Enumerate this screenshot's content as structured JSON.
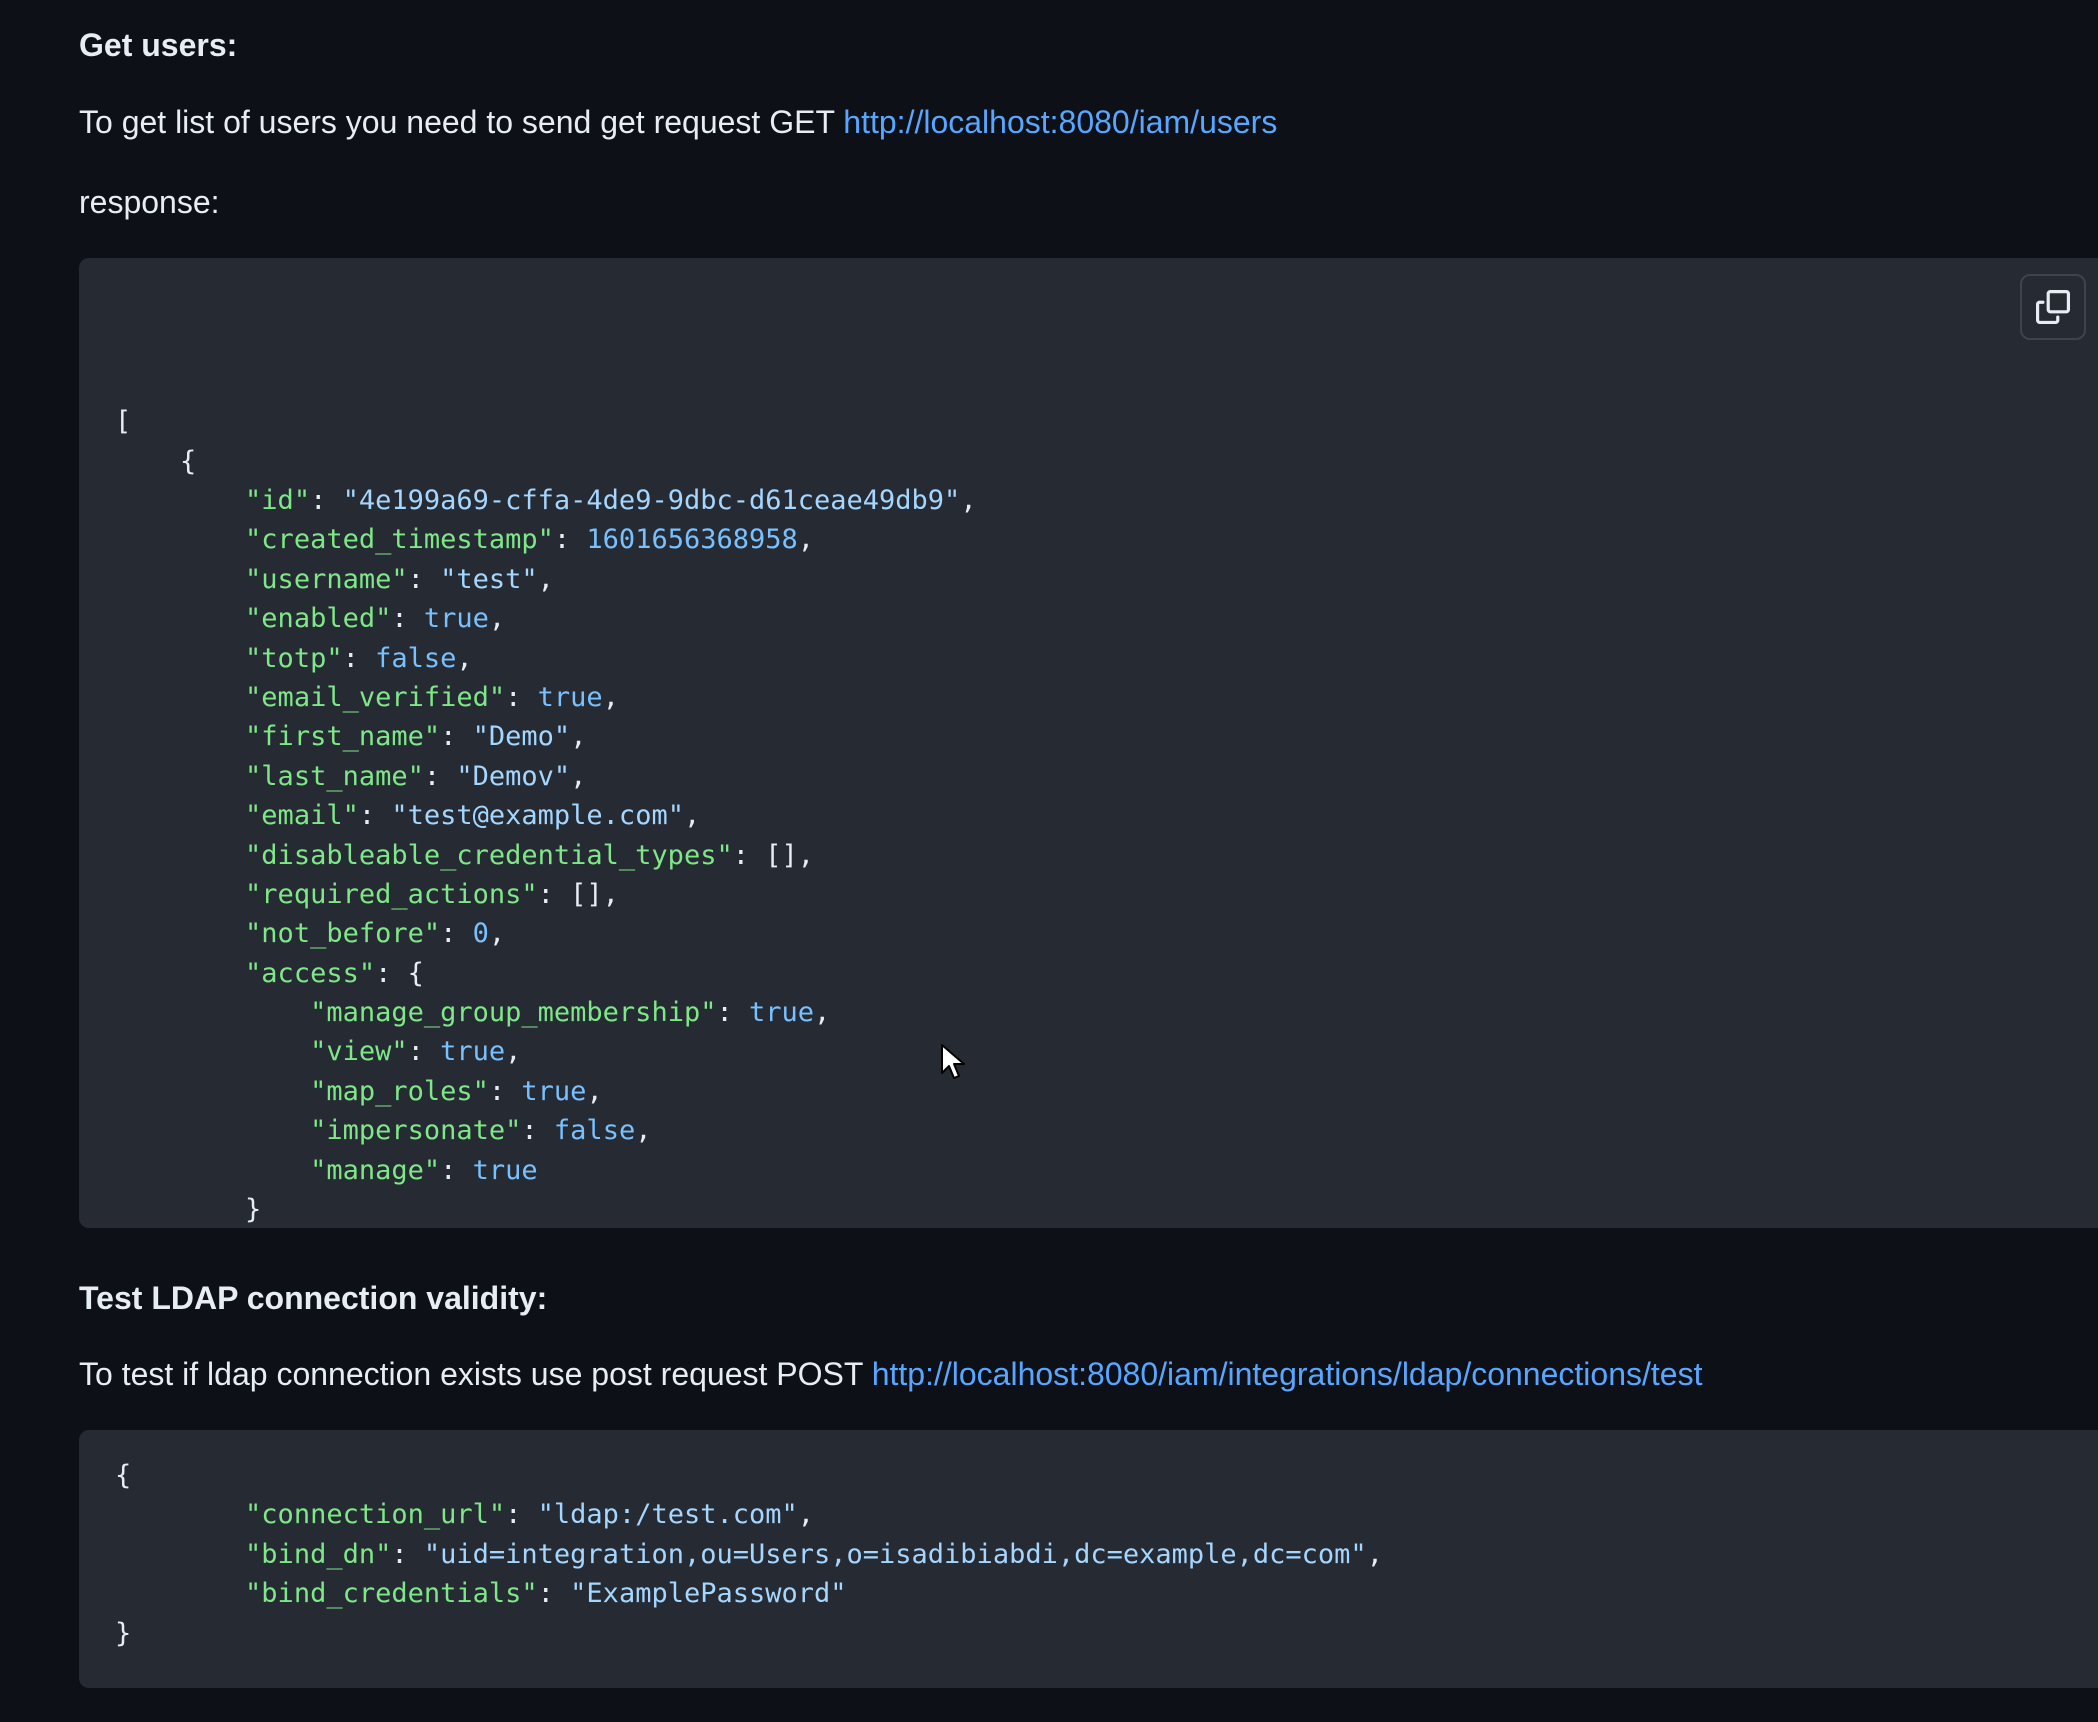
{
  "section1": {
    "heading": "Get users:",
    "intro_text": "To get list of users you need to send get request GET ",
    "intro_link": "http://localhost:8080/iam/users",
    "response_label": "response:",
    "copy_icon": "copy-icon",
    "code": [
      [
        [
          "p",
          "["
        ]
      ],
      [
        [
          "p",
          "    {"
        ]
      ],
      [
        [
          "p",
          "        "
        ],
        [
          "k",
          "\"id\""
        ],
        [
          "p",
          ": "
        ],
        [
          "s",
          "\"4e199a69-cffa-4de9-9dbc-d61ceae49db9\""
        ],
        [
          "p",
          ","
        ]
      ],
      [
        [
          "p",
          "        "
        ],
        [
          "k",
          "\"created_timestamp\""
        ],
        [
          "p",
          ": "
        ],
        [
          "n",
          "1601656368958"
        ],
        [
          "p",
          ","
        ]
      ],
      [
        [
          "p",
          "        "
        ],
        [
          "k",
          "\"username\""
        ],
        [
          "p",
          ": "
        ],
        [
          "s",
          "\"test\""
        ],
        [
          "p",
          ","
        ]
      ],
      [
        [
          "p",
          "        "
        ],
        [
          "k",
          "\"enabled\""
        ],
        [
          "p",
          ": "
        ],
        [
          "n",
          "true"
        ],
        [
          "p",
          ","
        ]
      ],
      [
        [
          "p",
          "        "
        ],
        [
          "k",
          "\"totp\""
        ],
        [
          "p",
          ": "
        ],
        [
          "n",
          "false"
        ],
        [
          "p",
          ","
        ]
      ],
      [
        [
          "p",
          "        "
        ],
        [
          "k",
          "\"email_verified\""
        ],
        [
          "p",
          ": "
        ],
        [
          "n",
          "true"
        ],
        [
          "p",
          ","
        ]
      ],
      [
        [
          "p",
          "        "
        ],
        [
          "k",
          "\"first_name\""
        ],
        [
          "p",
          ": "
        ],
        [
          "s",
          "\"Demo\""
        ],
        [
          "p",
          ","
        ]
      ],
      [
        [
          "p",
          "        "
        ],
        [
          "k",
          "\"last_name\""
        ],
        [
          "p",
          ": "
        ],
        [
          "s",
          "\"Demov\""
        ],
        [
          "p",
          ","
        ]
      ],
      [
        [
          "p",
          "        "
        ],
        [
          "k",
          "\"email\""
        ],
        [
          "p",
          ": "
        ],
        [
          "s",
          "\"test@example.com\""
        ],
        [
          "p",
          ","
        ]
      ],
      [
        [
          "p",
          "        "
        ],
        [
          "k",
          "\"disableable_credential_types\""
        ],
        [
          "p",
          ": [],"
        ]
      ],
      [
        [
          "p",
          "        "
        ],
        [
          "k",
          "\"required_actions\""
        ],
        [
          "p",
          ": [],"
        ]
      ],
      [
        [
          "p",
          "        "
        ],
        [
          "k",
          "\"not_before\""
        ],
        [
          "p",
          ": "
        ],
        [
          "n",
          "0"
        ],
        [
          "p",
          ","
        ]
      ],
      [
        [
          "p",
          "        "
        ],
        [
          "k",
          "\"access\""
        ],
        [
          "p",
          ": {"
        ]
      ],
      [
        [
          "p",
          "            "
        ],
        [
          "k",
          "\"manage_group_membership\""
        ],
        [
          "p",
          ": "
        ],
        [
          "n",
          "true"
        ],
        [
          "p",
          ","
        ]
      ],
      [
        [
          "p",
          "            "
        ],
        [
          "k",
          "\"view\""
        ],
        [
          "p",
          ": "
        ],
        [
          "n",
          "true"
        ],
        [
          "p",
          ","
        ]
      ],
      [
        [
          "p",
          "            "
        ],
        [
          "k",
          "\"map_roles\""
        ],
        [
          "p",
          ": "
        ],
        [
          "n",
          "true"
        ],
        [
          "p",
          ","
        ]
      ],
      [
        [
          "p",
          "            "
        ],
        [
          "k",
          "\"impersonate\""
        ],
        [
          "p",
          ": "
        ],
        [
          "n",
          "false"
        ],
        [
          "p",
          ","
        ]
      ],
      [
        [
          "p",
          "            "
        ],
        [
          "k",
          "\"manage\""
        ],
        [
          "p",
          ": "
        ],
        [
          "n",
          "true"
        ]
      ],
      [
        [
          "p",
          "        }"
        ]
      ],
      [
        [
          "p",
          "    }"
        ]
      ],
      [
        [
          "p",
          "]"
        ]
      ]
    ]
  },
  "section2": {
    "heading": "Test LDAP connection validity:",
    "intro_text": "To test if ldap connection exists use post request POST ",
    "intro_link": "http://localhost:8080/iam/integrations/ldap/connections/test",
    "code": [
      [
        [
          "p",
          "{"
        ]
      ],
      [
        [
          "p",
          "        "
        ],
        [
          "k",
          "\"connection_url\""
        ],
        [
          "p",
          ": "
        ],
        [
          "s",
          "\"ldap:/test.com\""
        ],
        [
          "p",
          ","
        ]
      ],
      [
        [
          "p",
          "        "
        ],
        [
          "k",
          "\"bind_dn\""
        ],
        [
          "p",
          ": "
        ],
        [
          "s",
          "\"uid=integration,ou=Users,o=isadibiabdi,dc=example,dc=com\""
        ],
        [
          "p",
          ","
        ]
      ],
      [
        [
          "p",
          "        "
        ],
        [
          "k",
          "\"bind_credentials\""
        ],
        [
          "p",
          ": "
        ],
        [
          "s",
          "\"ExamplePassword\""
        ]
      ],
      [
        [
          "p",
          "}"
        ]
      ]
    ]
  },
  "cursor": "pointer-cursor-icon",
  "colors": {
    "background": "#0d1117",
    "code_background": "#262b33",
    "link": "#58a6ff",
    "key": "#7ee787",
    "string": "#a5d6ff",
    "number": "#79c0ff"
  }
}
